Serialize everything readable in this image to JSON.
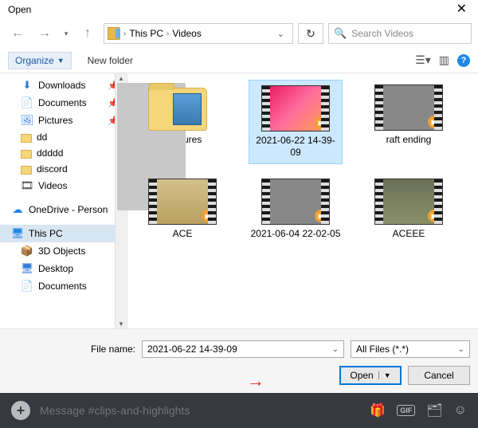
{
  "window": {
    "title": "Open"
  },
  "nav": {
    "breadcrumb": {
      "loc1": "This PC",
      "loc2": "Videos"
    },
    "search_placeholder": "Search Videos"
  },
  "toolbar": {
    "organize": "Organize",
    "newfolder": "New folder"
  },
  "sidebar": {
    "items": [
      {
        "label": "Downloads",
        "icon": "dl",
        "pinned": true
      },
      {
        "label": "Documents",
        "icon": "doc",
        "pinned": true
      },
      {
        "label": "Pictures",
        "icon": "pic",
        "pinned": true
      },
      {
        "label": "dd",
        "icon": "fld"
      },
      {
        "label": "ddddd",
        "icon": "fld"
      },
      {
        "label": "discord",
        "icon": "fld"
      },
      {
        "label": "Videos",
        "icon": "vid"
      }
    ],
    "onedrive": "OneDrive - Person",
    "thispc": "This PC",
    "thispc_children": [
      {
        "label": "3D Objects",
        "icon": "obj"
      },
      {
        "label": "Desktop",
        "icon": "desk"
      },
      {
        "label": "Documents",
        "icon": "doc"
      }
    ]
  },
  "files": [
    {
      "label": "Captures",
      "kind": "folder"
    },
    {
      "label": "2021-06-22 14-39-09",
      "kind": "video",
      "img": "pink",
      "selected": true
    },
    {
      "label": "raft ending",
      "kind": "video",
      "img": "dark"
    },
    {
      "label": "ACE",
      "kind": "video",
      "img": "tan"
    },
    {
      "label": "2021-06-04 22-02-05",
      "kind": "video",
      "img": "tan2"
    },
    {
      "label": "ACEEE",
      "kind": "video",
      "img": "tan3"
    }
  ],
  "footer": {
    "filename_label": "File name:",
    "filename_value": "2021-06-22 14-39-09",
    "filter": "All Files (*.*)",
    "open": "Open",
    "cancel": "Cancel"
  },
  "discord": {
    "placeholder": "Message #clips-and-highlights",
    "gif": "GIF"
  }
}
